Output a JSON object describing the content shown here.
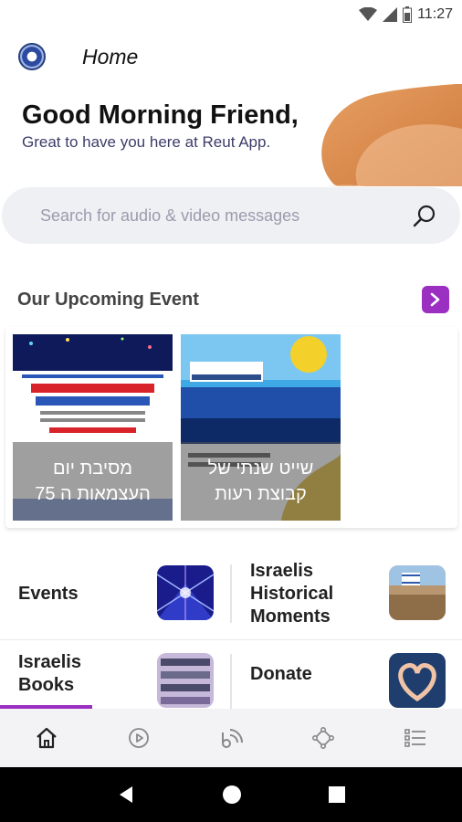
{
  "status_bar": {
    "time": "11:27"
  },
  "app_bar": {
    "title": "Home",
    "logo_icon": "reut-logo-icon"
  },
  "greeting": {
    "title": "Good Morning Friend,",
    "subtitle": "Great to have you here at Reut App."
  },
  "search": {
    "placeholder": "Search for audio & video messages",
    "icon": "search-icon"
  },
  "upcoming": {
    "title": "Our Upcoming Event",
    "arrow_icon": "chevron-right-icon",
    "events": [
      {
        "caption_line1": "מסיבת יום",
        "caption_line2": "העצמאות ה 75"
      },
      {
        "caption_line1": "שייט שנתי של",
        "caption_line2": "קבוצת רעות"
      }
    ]
  },
  "categories": [
    {
      "label_line1": "Events",
      "label_line2": "",
      "label_line3": ""
    },
    {
      "label_line1": "Israelis",
      "label_line2": "Historical",
      "label_line3": "Moments"
    },
    {
      "label_line1": "Israelis",
      "label_line2": "Books",
      "label_line3": ""
    },
    {
      "label_line1": "Donate",
      "label_line2": "",
      "label_line3": ""
    }
  ],
  "bottom_nav": {
    "items": [
      "home-icon",
      "play-icon",
      "podcast-icon",
      "community-icon",
      "menu-list-icon"
    ],
    "active": "home-icon"
  },
  "colors": {
    "accent": "#9b2fc2",
    "blob": "#d9823e"
  }
}
